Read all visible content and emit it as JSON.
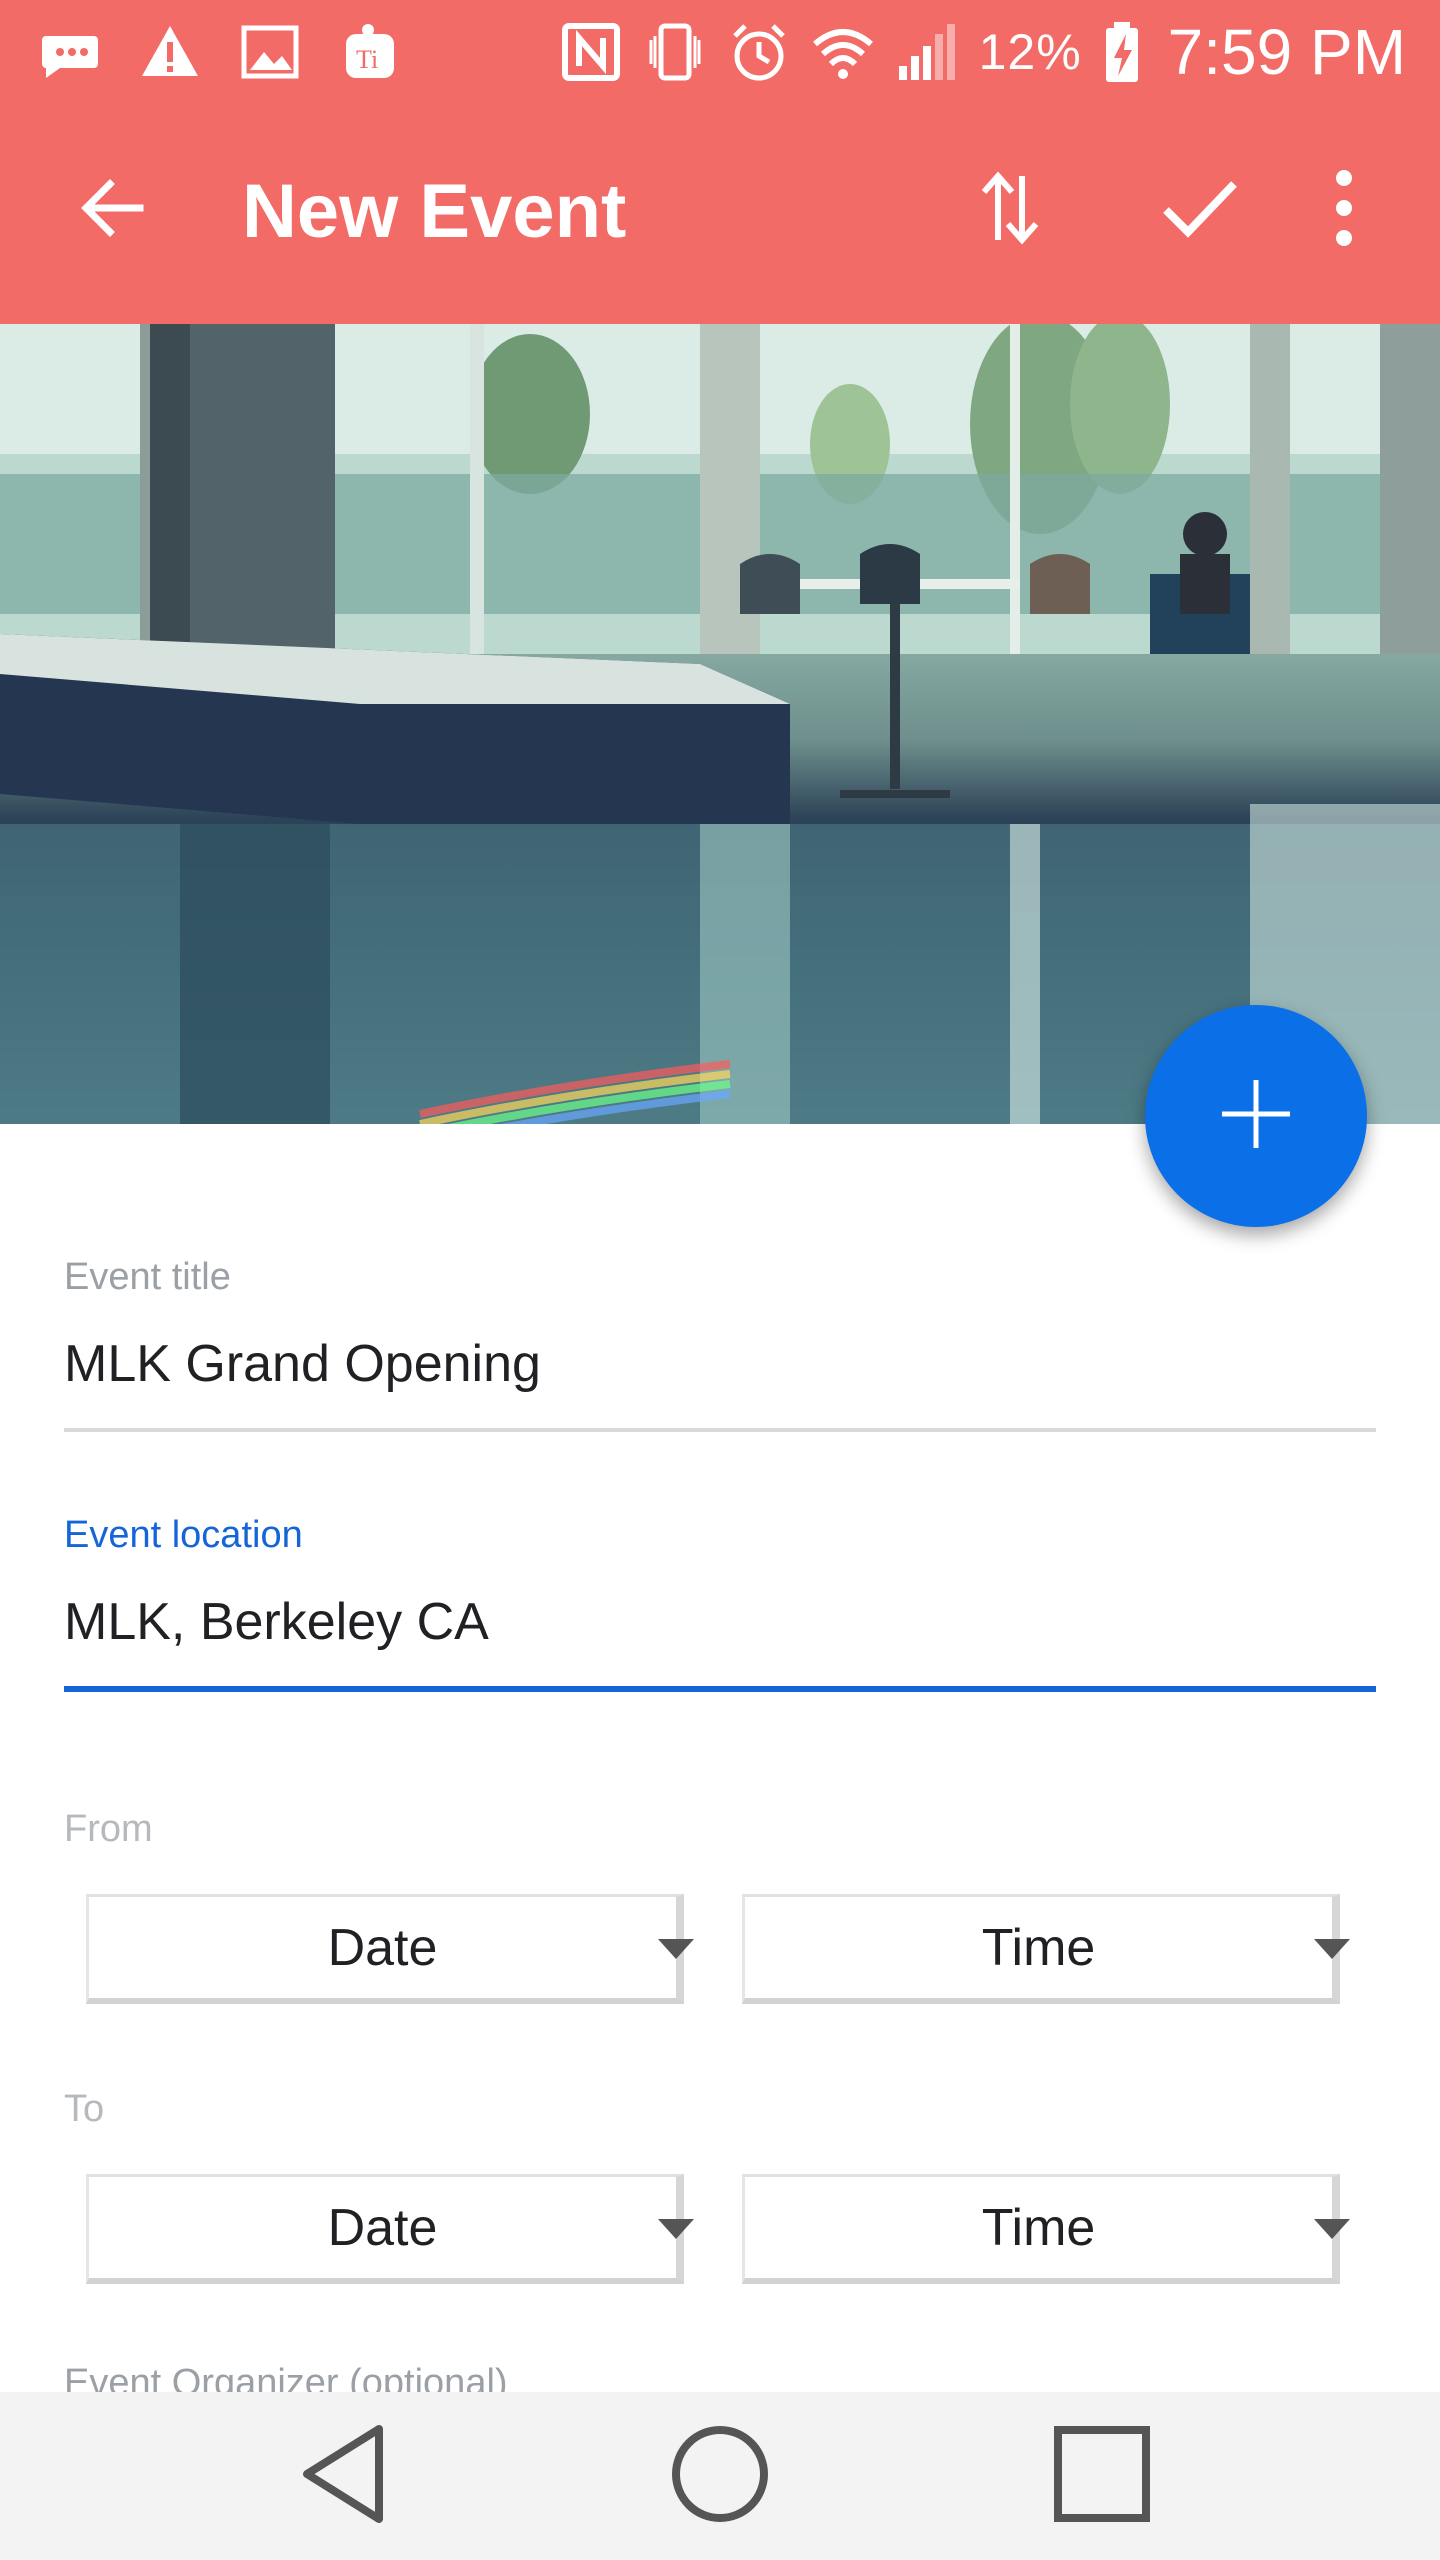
{
  "status_bar": {
    "battery_percent": "12%",
    "time": "7:59 PM",
    "icons": [
      "message-icon",
      "warning-icon",
      "image-icon",
      "app-notification-icon",
      "nfc-icon",
      "vibrate-icon",
      "alarm-icon",
      "wifi-icon",
      "signal-icon",
      "battery-charging-icon"
    ]
  },
  "app_bar": {
    "title": "New Event",
    "back_icon": "arrow-back-icon",
    "actions": [
      "swap-vertical-icon",
      "check-icon",
      "more-vertical-icon"
    ]
  },
  "hero": {
    "image": "event-photo-cafeteria-interior"
  },
  "fab": {
    "icon": "plus-icon",
    "color": "#0b6fe8"
  },
  "form": {
    "title": {
      "label": "Event title",
      "value": "MLK Grand Opening"
    },
    "location": {
      "label": "Event location",
      "value": "MLK, Berkeley CA",
      "focused": true
    },
    "from": {
      "label": "From",
      "date": "Date",
      "time": "Time"
    },
    "to": {
      "label": "To",
      "date": "Date",
      "time": "Time"
    },
    "organizer": {
      "label": "Event Organizer (optional)"
    }
  },
  "nav_bar": {
    "buttons": [
      "nav-back-icon",
      "nav-home-icon",
      "nav-recent-icon"
    ]
  },
  "colors": {
    "accent": "#f26b67",
    "focus": "#1565d8",
    "fab": "#0b6fe8"
  }
}
